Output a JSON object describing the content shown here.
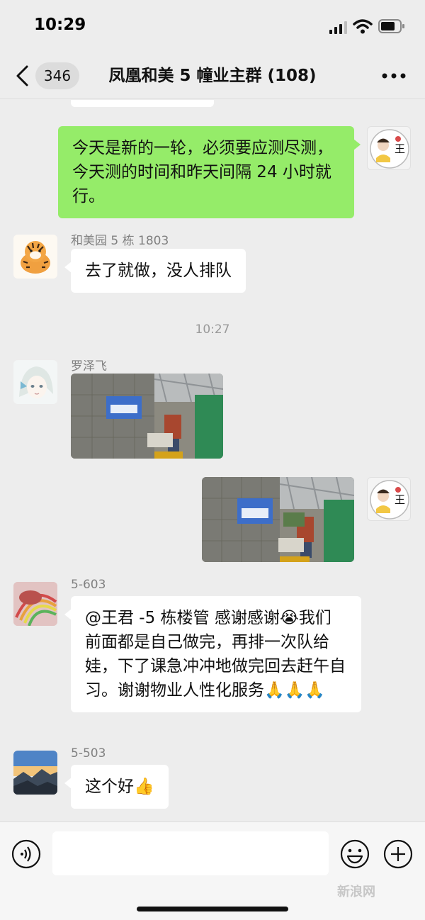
{
  "status_bar": {
    "time": "10:29"
  },
  "nav": {
    "unread_count": "346",
    "title": "凤凰和美 5 幢业主群 (108)"
  },
  "messages": [
    {
      "direction": "out",
      "text": "今天是新的一轮，必须要应测尽测，今天测的时间和昨天间隔 24 小时就行。"
    },
    {
      "direction": "in",
      "sender": "和美园 5 栋 1803",
      "text": "去了就做，没人排队"
    },
    {
      "type": "time",
      "text": "10:27"
    },
    {
      "direction": "in",
      "sender": "罗泽飞",
      "image": "photo"
    },
    {
      "direction": "out",
      "image": "photo"
    },
    {
      "direction": "in",
      "sender": "5-603",
      "text": "@王君 -5 栋楼管 感谢感谢😭我们前面都是自己做完，再排一次队给娃，下了课急冲冲地做完回去赶午自习。谢谢物业人性化服务🙏🙏🙏"
    },
    {
      "direction": "in",
      "sender": "5-503",
      "text": "这个好👍"
    }
  ],
  "avatars": {
    "self_label": "王"
  },
  "input": {
    "placeholder": ""
  },
  "watermark": "新浪网"
}
